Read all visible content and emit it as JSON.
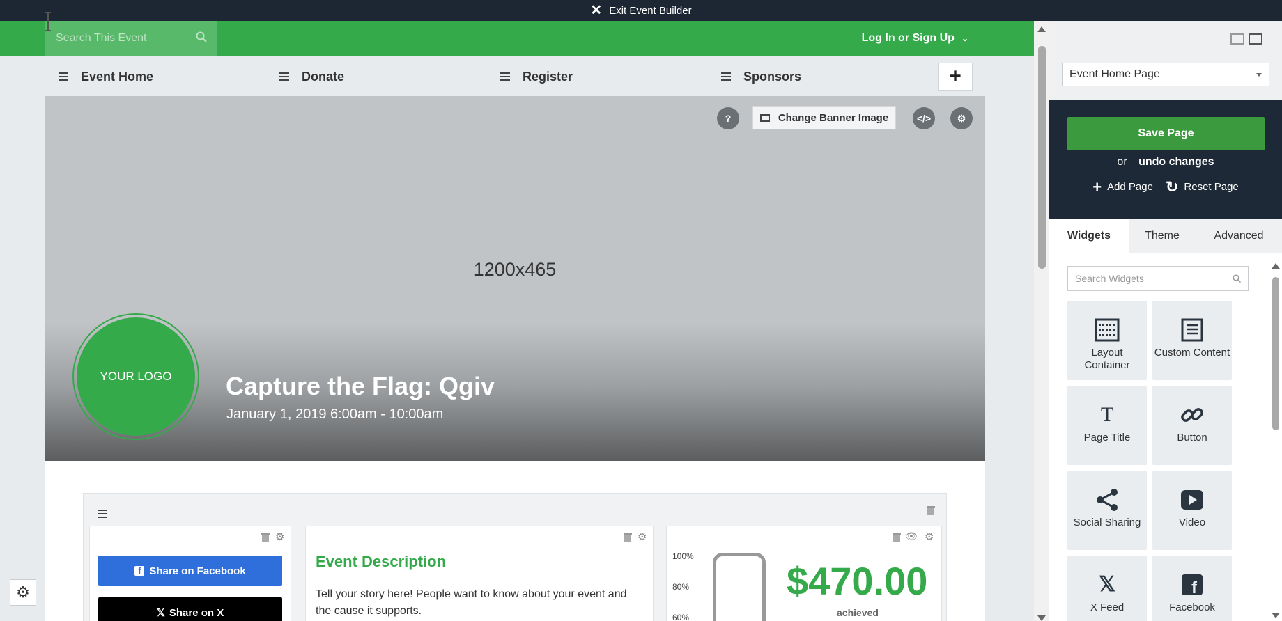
{
  "topbar": {
    "exit_label": "Exit Event Builder"
  },
  "header": {
    "search_placeholder": "Search This Event",
    "login_label": "Log In or Sign Up"
  },
  "nav": {
    "items": [
      {
        "label": "Event Home"
      },
      {
        "label": "Donate"
      },
      {
        "label": "Register"
      },
      {
        "label": "Sponsors"
      }
    ],
    "add_label": "+"
  },
  "banner": {
    "size_label": "1200x465",
    "change_image_label": "Change Banner Image",
    "logo_text": "YOUR LOGO",
    "event_title": "Capture the Flag: Qgiv",
    "event_date": "January 1, 2019 6:00am - 10:00am"
  },
  "widgets_content": {
    "share_facebook": "Share on Facebook",
    "share_x": "Share on X",
    "description_title": "Event Description",
    "description_text": "Tell your story here! People want to know about your event and the cause it supports.",
    "thermometer_ticks": [
      "100%",
      "80%",
      "60%"
    ],
    "amount": "$470.00",
    "achieved_label": "achieved"
  },
  "panel": {
    "page_select_value": "Event Home Page",
    "save_label": "Save Page",
    "or_label": "or",
    "undo_label": "undo changes",
    "add_page_label": "Add Page",
    "reset_page_label": "Reset Page",
    "tabs": [
      {
        "label": "Widgets",
        "active": true
      },
      {
        "label": "Theme",
        "active": false
      },
      {
        "label": "Advanced",
        "active": false
      }
    ],
    "widget_search_placeholder": "Search Widgets",
    "widgets": [
      {
        "label": "Layout Container",
        "icon": "layout-container-icon"
      },
      {
        "label": "Custom Content",
        "icon": "document-icon"
      },
      {
        "label": "Page Title",
        "icon": "title-icon"
      },
      {
        "label": "Button",
        "icon": "link-icon"
      },
      {
        "label": "Social Sharing",
        "icon": "share-icon"
      },
      {
        "label": "Video",
        "icon": "video-icon"
      },
      {
        "label": "X Feed",
        "icon": "x-icon"
      },
      {
        "label": "Facebook",
        "icon": "facebook-icon"
      }
    ]
  },
  "colors": {
    "brand_green": "#35aa4b",
    "dark_navy": "#1d2936",
    "facebook_blue": "#2e6fdc"
  }
}
